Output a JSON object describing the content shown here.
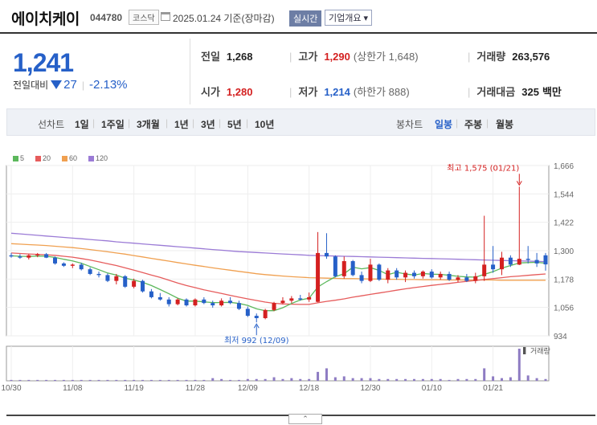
{
  "header": {
    "name": "에이치케이",
    "code": "044780",
    "market": "코스닥",
    "date": "2025.01.24 기준(장마감)",
    "realtime_label": "실시간",
    "info_label": "기업개요 ▾"
  },
  "price": {
    "current": "1,241",
    "change_label": "전일대비",
    "change": "27",
    "change_pct": "-2.13%"
  },
  "stats": {
    "prev_label": "전일",
    "prev": "1,268",
    "high_label": "고가",
    "high": "1,290",
    "upper_limit": "(상한가 1,648)",
    "volume_label": "거래량",
    "volume": "263,576",
    "open_label": "시가",
    "open": "1,280",
    "low_label": "저가",
    "low": "1,214",
    "lower_limit": "(하한가 888)",
    "amount_label": "거래대금",
    "amount": "325",
    "amount_unit": "백만"
  },
  "toolbar": {
    "line_chart": "선차트",
    "periods": [
      "1일",
      "1주일",
      "3개월",
      "1년",
      "3년",
      "5년",
      "10년"
    ],
    "candle_chart": "봉차트",
    "candle_periods": [
      "일봉",
      "주봉",
      "월봉"
    ],
    "candle_active": "일봉"
  },
  "colors": {
    "up": "#d42020",
    "down": "#2660c8",
    "ma5": "#5cb85c",
    "ma20": "#e65c5c",
    "ma60": "#f0a050",
    "ma120": "#9b7bd6",
    "volume": "#8e7cc3"
  },
  "chart_data": {
    "type": "candlestick",
    "legend": [
      "5",
      "20",
      "60",
      "120"
    ],
    "y_ticks": [
      "1,666",
      "1,544",
      "1,422",
      "1,300",
      "1,178",
      "1,056",
      "934"
    ],
    "y_range": [
      934,
      1666
    ],
    "x_ticks": [
      {
        "label": "10/30",
        "idx": 0
      },
      {
        "label": "11/08",
        "idx": 7
      },
      {
        "label": "11/19",
        "idx": 14
      },
      {
        "label": "11/28",
        "idx": 21
      },
      {
        "label": "12/09",
        "idx": 27
      },
      {
        "label": "12/18",
        "idx": 34
      },
      {
        "label": "12/30",
        "idx": 41
      },
      {
        "label": "01/10",
        "idx": 48
      },
      {
        "label": "01/21",
        "idx": 55
      }
    ],
    "high_note": "최고 1,575 (01/21)",
    "low_note": "최저 992 (12/09)",
    "volume_label": "거래량",
    "candles": [
      [
        1280,
        1290,
        1270,
        1275
      ],
      [
        1275,
        1285,
        1265,
        1270
      ],
      [
        1270,
        1285,
        1262,
        1280
      ],
      [
        1280,
        1290,
        1272,
        1285
      ],
      [
        1285,
        1290,
        1268,
        1270
      ],
      [
        1270,
        1275,
        1240,
        1245
      ],
      [
        1245,
        1250,
        1230,
        1235
      ],
      [
        1235,
        1245,
        1225,
        1240
      ],
      [
        1240,
        1248,
        1215,
        1220
      ],
      [
        1220,
        1228,
        1195,
        1200
      ],
      [
        1200,
        1210,
        1185,
        1195
      ],
      [
        1195,
        1202,
        1165,
        1170
      ],
      [
        1170,
        1200,
        1155,
        1190
      ],
      [
        1190,
        1195,
        1140,
        1145
      ],
      [
        1145,
        1180,
        1138,
        1170
      ],
      [
        1170,
        1175,
        1120,
        1125
      ],
      [
        1125,
        1135,
        1095,
        1100
      ],
      [
        1100,
        1118,
        1085,
        1090
      ],
      [
        1090,
        1100,
        1060,
        1070
      ],
      [
        1070,
        1095,
        1065,
        1090
      ],
      [
        1090,
        1095,
        1060,
        1065
      ],
      [
        1065,
        1095,
        1060,
        1090
      ],
      [
        1090,
        1100,
        1070,
        1075
      ],
      [
        1075,
        1085,
        1055,
        1065
      ],
      [
        1065,
        1095,
        1060,
        1085
      ],
      [
        1085,
        1100,
        1070,
        1075
      ],
      [
        1075,
        1085,
        1045,
        1050
      ],
      [
        1050,
        1060,
        1015,
        1020
      ],
      [
        1020,
        1030,
        992,
        1010
      ],
      [
        1010,
        1050,
        1005,
        1045
      ],
      [
        1045,
        1080,
        1040,
        1075
      ],
      [
        1075,
        1100,
        1070,
        1085
      ],
      [
        1085,
        1105,
        1075,
        1095
      ],
      [
        1095,
        1110,
        1085,
        1090
      ],
      [
        1090,
        1120,
        1080,
        1100
      ],
      [
        1080,
        1380,
        1078,
        1290
      ],
      [
        1290,
        1375,
        1265,
        1275
      ],
      [
        1275,
        1280,
        1185,
        1190
      ],
      [
        1190,
        1275,
        1180,
        1255
      ],
      [
        1255,
        1260,
        1190,
        1195
      ],
      [
        1195,
        1210,
        1160,
        1170
      ],
      [
        1170,
        1265,
        1165,
        1240
      ],
      [
        1240,
        1245,
        1170,
        1175
      ],
      [
        1175,
        1225,
        1160,
        1215
      ],
      [
        1215,
        1225,
        1175,
        1185
      ],
      [
        1185,
        1215,
        1165,
        1205
      ],
      [
        1205,
        1215,
        1180,
        1190
      ],
      [
        1190,
        1215,
        1180,
        1210
      ],
      [
        1210,
        1220,
        1180,
        1185
      ],
      [
        1185,
        1210,
        1175,
        1200
      ],
      [
        1200,
        1210,
        1170,
        1175
      ],
      [
        1175,
        1195,
        1165,
        1185
      ],
      [
        1185,
        1200,
        1165,
        1170
      ],
      [
        1170,
        1205,
        1160,
        1190
      ],
      [
        1190,
        1450,
        1170,
        1240
      ],
      [
        1240,
        1320,
        1205,
        1220
      ],
      [
        1220,
        1295,
        1195,
        1270
      ],
      [
        1270,
        1280,
        1230,
        1240
      ],
      [
        1240,
        1575,
        1238,
        1265
      ],
      [
        1265,
        1320,
        1245,
        1260
      ],
      [
        1260,
        1290,
        1230,
        1245
      ],
      [
        1280,
        1290,
        1214,
        1241
      ]
    ],
    "ma5": [
      1278,
      1276,
      1275,
      1277,
      1276,
      1271,
      1263,
      1256,
      1246,
      1232,
      1218,
      1204,
      1195,
      1182,
      1174,
      1164,
      1150,
      1133,
      1115,
      1096,
      1083,
      1083,
      1080,
      1077,
      1077,
      1078,
      1073,
      1065,
      1050,
      1042,
      1042,
      1055,
      1073,
      1088,
      1096,
      1144,
      1167,
      1188,
      1201,
      1229,
      1222,
      1227,
      1215,
      1197,
      1207,
      1200,
      1195,
      1202,
      1199,
      1198,
      1194,
      1190,
      1187,
      1186,
      1198,
      1210,
      1225,
      1236,
      1247,
      1249,
      1250,
      1246
    ],
    "ma20": [
      1290,
      1288,
      1286,
      1284,
      1282,
      1280,
      1276,
      1272,
      1266,
      1260,
      1252,
      1244,
      1236,
      1226,
      1216,
      1206,
      1195,
      1185,
      1173,
      1161,
      1150,
      1141,
      1132,
      1124,
      1116,
      1108,
      1100,
      1093,
      1086,
      1079,
      1074,
      1071,
      1070,
      1069,
      1069,
      1076,
      1082,
      1087,
      1093,
      1100,
      1106,
      1112,
      1118,
      1124,
      1130,
      1136,
      1141,
      1146,
      1151,
      1155,
      1159,
      1164,
      1168,
      1172,
      1176,
      1180,
      1184,
      1188,
      1191,
      1194,
      1197,
      1200
    ],
    "ma60": [
      1330,
      1328,
      1326,
      1324,
      1322,
      1319,
      1316,
      1313,
      1309,
      1305,
      1300,
      1295,
      1290,
      1285,
      1279,
      1273,
      1267,
      1261,
      1255,
      1249,
      1243,
      1237,
      1232,
      1226,
      1221,
      1216,
      1211,
      1206,
      1201,
      1197,
      1194,
      1191,
      1188,
      1186,
      1184,
      1183,
      1182,
      1181,
      1180,
      1180,
      1179,
      1178,
      1178,
      1177,
      1177,
      1176,
      1176,
      1175,
      1175,
      1175,
      1174,
      1174,
      1174,
      1174,
      1174,
      1174,
      1173,
      1173,
      1173,
      1173,
      1173,
      1173
    ],
    "ma120": [
      1375,
      1372,
      1369,
      1366,
      1363,
      1360,
      1357,
      1354,
      1351,
      1348,
      1345,
      1342,
      1338,
      1335,
      1332,
      1329,
      1326,
      1323,
      1320,
      1317,
      1314,
      1311,
      1308,
      1305,
      1302,
      1299,
      1296,
      1294,
      1292,
      1290,
      1288,
      1286,
      1284,
      1282,
      1280,
      1279,
      1278,
      1277,
      1276,
      1275,
      1274,
      1273,
      1272,
      1271,
      1270,
      1269,
      1268,
      1267,
      1266,
      1265,
      1264,
      1263,
      1262,
      1261,
      1260,
      1259,
      1258,
      1257,
      1256,
      1255,
      1254,
      1253
    ],
    "volume": [
      1,
      1,
      1,
      1,
      1,
      1,
      1,
      1,
      1,
      1,
      1,
      1,
      1,
      1,
      1,
      1,
      1,
      1,
      1,
      1,
      1,
      1,
      1,
      3,
      2,
      1,
      1,
      2,
      2,
      2,
      4,
      2,
      3,
      2,
      2,
      10,
      14,
      4,
      5,
      3,
      3,
      3,
      2,
      2,
      2,
      2,
      2,
      2,
      2,
      2,
      1,
      2,
      2,
      2,
      14,
      5,
      3,
      4,
      36,
      6,
      3,
      2
    ]
  }
}
